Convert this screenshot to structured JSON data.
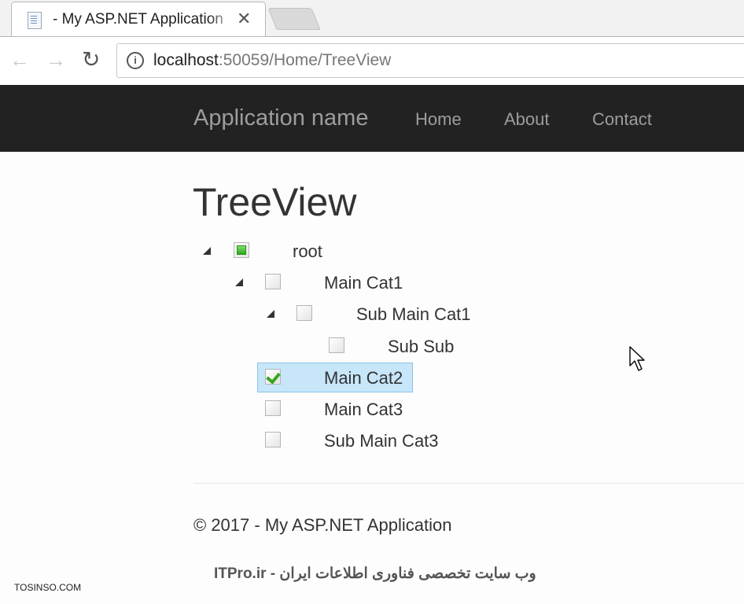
{
  "browser": {
    "tab_title": "- My ASP.NET Application",
    "tab_close": "✕",
    "address_host": "localhost",
    "address_rest": ":50059/Home/TreeView",
    "info_glyph": "i",
    "back_glyph": "←",
    "forward_glyph": "→",
    "reload_glyph": "↻"
  },
  "navbar": {
    "brand": "Application name",
    "links": [
      "Home",
      "About",
      "Contact"
    ]
  },
  "page": {
    "title": "TreeView"
  },
  "tree": [
    {
      "label": "root",
      "expanded": true,
      "check_state": "partial"
    },
    {
      "label": "Main Cat1",
      "expanded": true,
      "check_state": "unchecked"
    },
    {
      "label": "Sub Main Cat1",
      "expanded": true,
      "check_state": "unchecked"
    },
    {
      "label": "Sub Sub",
      "check_state": "unchecked"
    },
    {
      "label": "Main Cat2",
      "check_state": "checked",
      "selected": true
    },
    {
      "label": "Main Cat3",
      "check_state": "unchecked"
    },
    {
      "label": "Sub Main Cat3",
      "check_state": "unchecked"
    }
  ],
  "footer": {
    "text": "© 2017 - My ASP.NET Application"
  },
  "watermarks": {
    "itpro": "ITPro.ir - وب سایت تخصصی فناوری اطلاعات ایران",
    "tosinso": "TOSINSO.COM"
  },
  "colors": {
    "navbar_bg": "#222222",
    "navbar_text": "#9d9d9d",
    "selection_bg": "#c7e6fa",
    "check_green": "#39a523"
  }
}
